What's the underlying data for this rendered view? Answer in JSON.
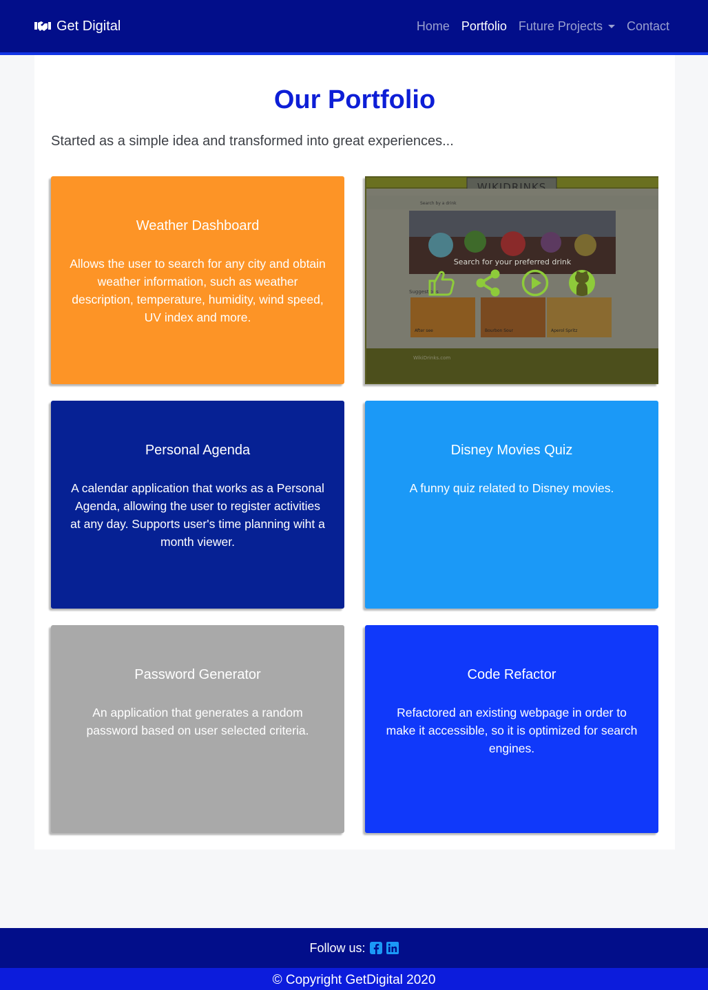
{
  "navbar": {
    "brand": "Get Digital",
    "brand_icon": "handshake-icon",
    "links": [
      {
        "label": "Home",
        "active": false
      },
      {
        "label": "Portfolio",
        "active": true
      },
      {
        "label": "Future Projects",
        "active": false,
        "dropdown": true
      },
      {
        "label": "Contact",
        "active": false
      }
    ]
  },
  "main": {
    "title": "Our Portfolio",
    "subtitle": "Started as a simple idea and transformed into great experiences..."
  },
  "cards": [
    {
      "title": "Weather Dashboard",
      "text": "Allows the user to search for any city and obtain weather information, such as weather description, temperature, humidity, wind speed, UV index and more.",
      "color": "#fd9426"
    },
    {
      "title": "Personal Agenda",
      "text": "A calendar application that works as a Personal Agenda, allowing the user to register activities at any day. Supports user's time planning wiht a month viewer.",
      "color": "#062194"
    },
    {
      "title": "Disney Movies Quiz",
      "text": "A funny quiz related to Disney movies.",
      "color": "#1b99f7"
    },
    {
      "title": "Password Generator",
      "text": "An application that generates a random password based on user selected criteria.",
      "color": "#a9a9a9"
    },
    {
      "title": "Code Refactor",
      "text": "Refactored an existing webpage in order to make it accessible, so it is optimized for search engines.",
      "color": "#1039fa"
    }
  ],
  "project_preview": {
    "site_logo": "WIKIDRINKS",
    "search_placeholder": "Search by a drink",
    "hero_text": "Search for your preferred drink",
    "section_label": "Suggestions",
    "items": [
      "After see",
      "Bourbon Sour",
      "Aperol Spritz"
    ],
    "footer_brand": "WikiDrinks.com",
    "overlay_icons": [
      "thumbs-up-icon",
      "share-icon",
      "play-icon",
      "github-icon"
    ],
    "overlay_color": "#8ecb3a"
  },
  "footer": {
    "follow_label": "Follow us:",
    "social_icons": [
      "facebook-icon",
      "linkedin-icon"
    ],
    "copyright": "© Copyright GetDigital 2020"
  }
}
